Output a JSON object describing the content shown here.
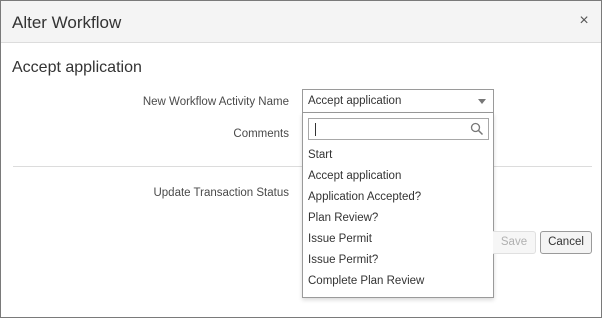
{
  "dialog": {
    "title": "Alter Workflow",
    "close_glyph": "×"
  },
  "section": {
    "title": "Accept application"
  },
  "form": {
    "activity_label": "New Workflow Activity Name",
    "comments_label": "Comments",
    "status_label": "Update Transaction Status"
  },
  "select": {
    "value": "Accept application",
    "search_value": "",
    "search_placeholder": "",
    "options": [
      "Start",
      "Accept application",
      "Application Accepted?",
      "Plan Review?",
      "Issue Permit",
      "Issue Permit?",
      "Complete Plan Review"
    ]
  },
  "buttons": {
    "save": "Save",
    "cancel": "Cancel"
  },
  "icons": {
    "close": "close-icon",
    "caret": "chevron-down-icon",
    "search": "search-icon"
  },
  "colors": {
    "header_bg": "#f4f4f4",
    "border": "#9a9a9a",
    "disabled_text": "#b0b0b0"
  }
}
